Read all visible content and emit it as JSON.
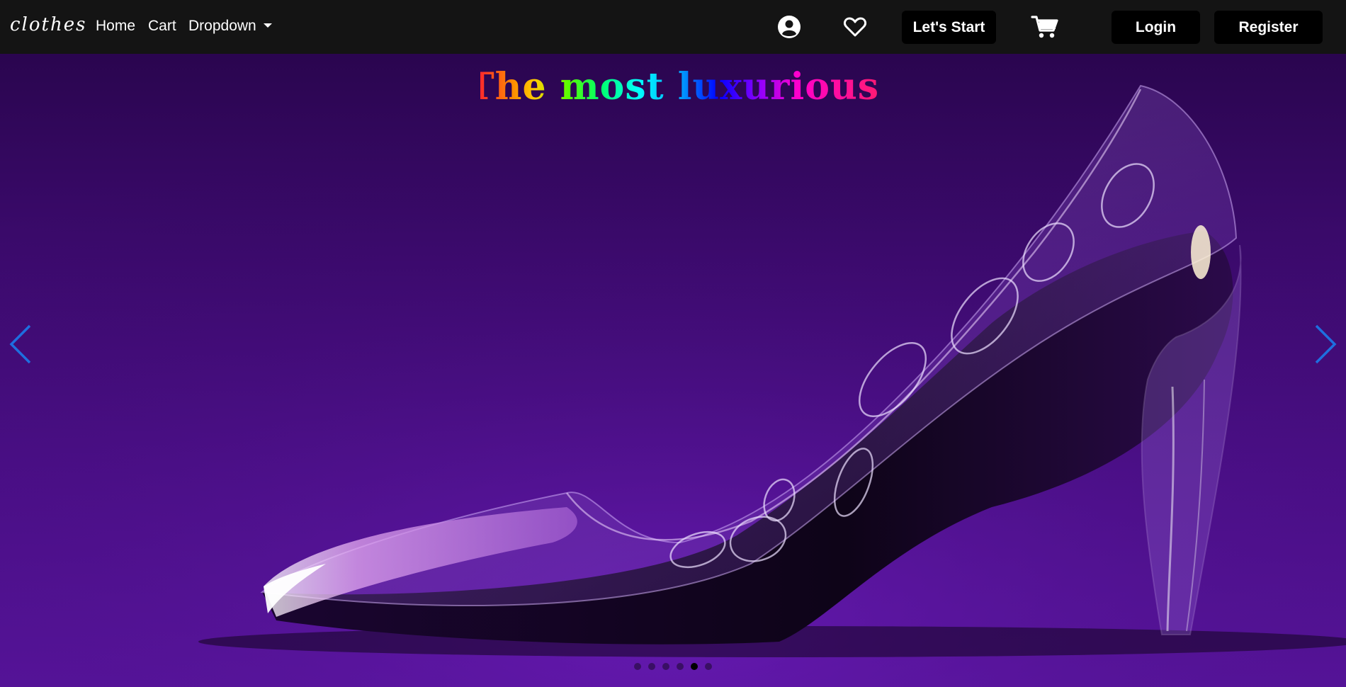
{
  "navbar": {
    "brand": "clothes",
    "links": [
      {
        "label": "Home"
      },
      {
        "label": "Cart"
      },
      {
        "label": "Dropdown"
      }
    ],
    "icons": [
      "user-circle-icon",
      "heart-icon",
      "cart-icon"
    ],
    "start_button": "Let's Start",
    "login_button": "Login",
    "register_button": "Register"
  },
  "hero": {
    "title": "The most luxurious",
    "slide_count": 6,
    "active_slide": 5
  },
  "colors": {
    "navbar_bg": "#141414",
    "button_bg": "#000000",
    "hero_bg": "#4c0f8a",
    "arrow": "#1e6fe0"
  }
}
